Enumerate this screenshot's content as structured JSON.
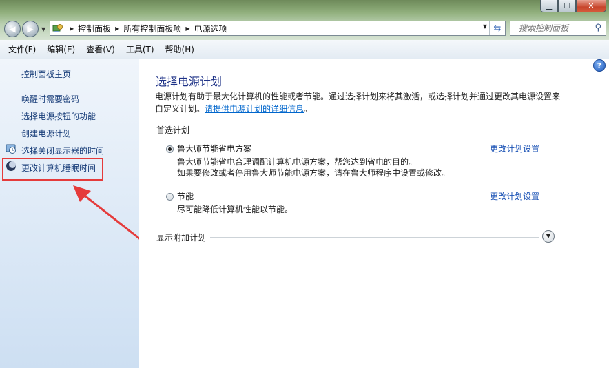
{
  "address_bar": {
    "crumbs": [
      "控制面板",
      "所有控制面板项",
      "电源选项"
    ]
  },
  "search": {
    "placeholder": "搜索控制面板"
  },
  "menu": {
    "file": "文件(F)",
    "edit": "编辑(E)",
    "view": "查看(V)",
    "tools": "工具(T)",
    "help": "帮助(H)"
  },
  "sidebar": {
    "home": "控制面板主页",
    "items": [
      {
        "label": "唤醒时需要密码"
      },
      {
        "label": "选择电源按钮的功能"
      },
      {
        "label": "创建电源计划"
      },
      {
        "label": "选择关闭显示器的时间",
        "icon": "clock-monitor-icon"
      },
      {
        "label": "更改计算机睡眠时间",
        "icon": "moon-sleep-icon"
      }
    ]
  },
  "main": {
    "title": "选择电源计划",
    "description": "电源计划有助于最大化计算机的性能或者节能。通过选择计划来将其激活，或选择计划并通过更改其电源设置来自定义计划。",
    "description_link": "请提供电源计划的详细信息",
    "description_end": "。",
    "preferred_group": "首选计划",
    "plans": [
      {
        "name": "鲁大师节能省电方案",
        "selected": true,
        "desc_line1": "鲁大师节能省电合理调配计算机电源方案，帮您达到省电的目的。",
        "desc_line2": "如果要修改或者停用鲁大师节能电源方案，请在鲁大师程序中设置或修改。",
        "link": "更改计划设置"
      },
      {
        "name": "节能",
        "selected": false,
        "desc_line1": "尽可能降低计算机性能以节能。",
        "link": "更改计划设置"
      }
    ],
    "additional_group": "显示附加计划"
  },
  "colors": {
    "highlight_box": "#e53b3b",
    "link": "#1a52b5",
    "title": "#1e3287"
  }
}
